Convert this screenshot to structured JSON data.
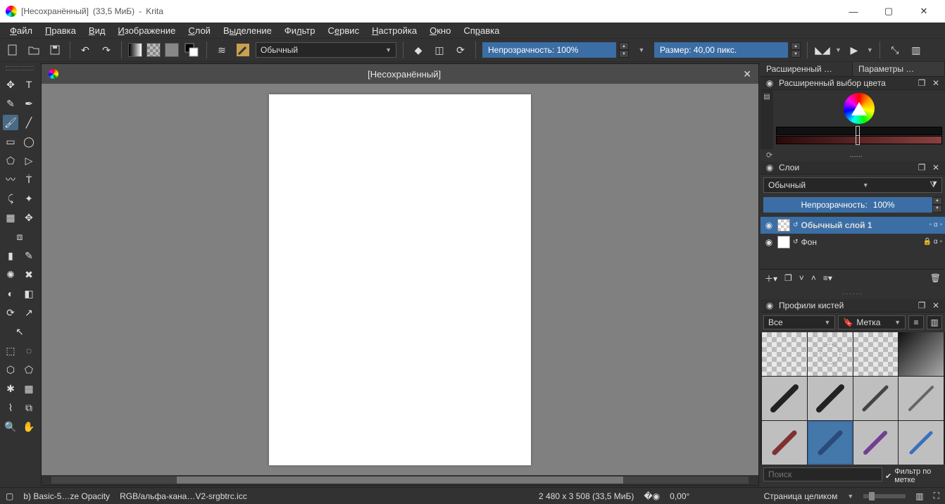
{
  "title": {
    "doc_name": "[Несохранённый]",
    "size": "(33,5 МиБ)",
    "app": "Krita",
    "sep": " - "
  },
  "menu": [
    "Файл",
    "Правка",
    "Вид",
    "Изображение",
    "Слой",
    "Выделение",
    "Фильтр",
    "Сервис",
    "Настройка",
    "Окно",
    "Справка"
  ],
  "toolbar": {
    "blend_mode": "Обычный",
    "opacity_label": "Непрозрачность: 100%",
    "size_label": "Размер: 40,00 пикс."
  },
  "document": {
    "tab_title": "[Несохранённый]"
  },
  "right": {
    "tabs": [
      "Расширенный …",
      "Параметры …"
    ],
    "color_panel": {
      "title": "Расширенный выбор цвета",
      "dots": "......"
    },
    "layers_panel": {
      "title": "Слои",
      "blend": "Обычный",
      "opacity_label": "Непрозрачность:",
      "opacity_value": "100%",
      "dots": "......",
      "layers": [
        {
          "name": "Обычный слой 1",
          "selected": true,
          "bg": false
        },
        {
          "name": "Фон",
          "selected": false,
          "bg": true
        }
      ]
    },
    "brushes_panel": {
      "title": "Профили кистей",
      "tag_all": "Все",
      "tag_label": "Метка",
      "search_placeholder": "Поиск",
      "filter_label": "Фильтр по метке"
    }
  },
  "status": {
    "brush": "b) Basic-5…ze Opacity",
    "colorspace": "RGB/альфа-кана…V2-srgbtrc.icc",
    "dims": "2 480 x 3 508 (33,5 МиБ)",
    "angle": "0,00°",
    "zoom": "Страница целиком"
  }
}
